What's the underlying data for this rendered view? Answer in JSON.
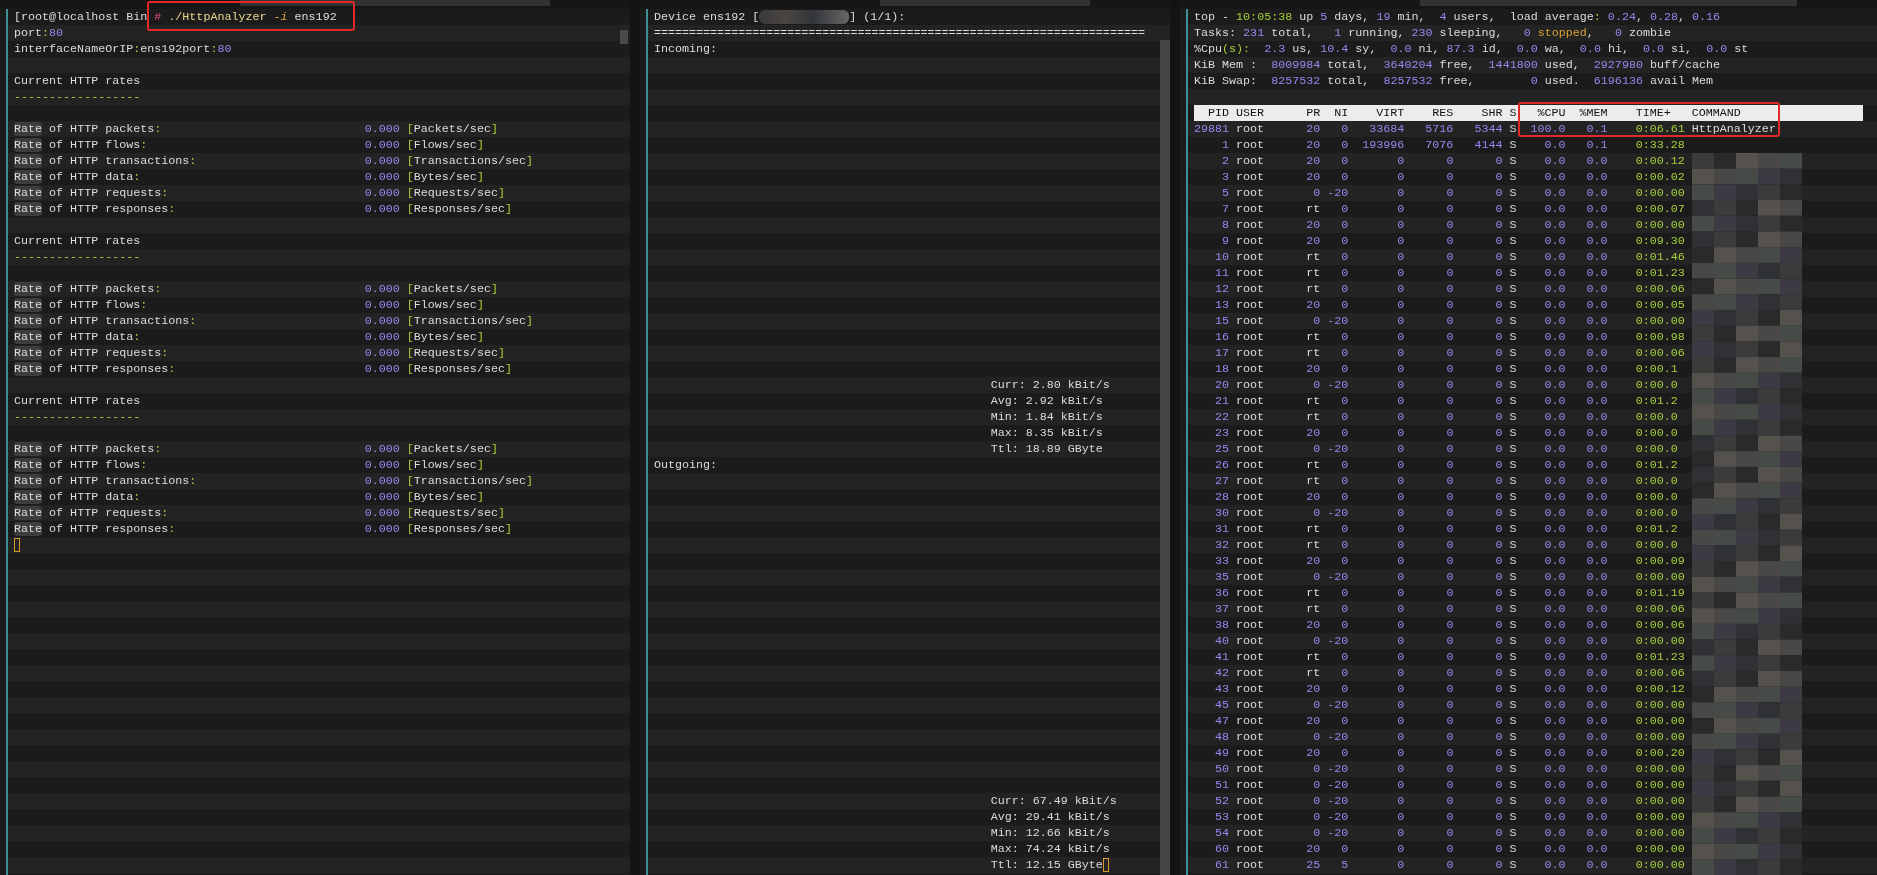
{
  "left": {
    "lines": [
      {
        "kind": "seg",
        "segs": [
          {
            "text": "[root@localhost Bin ",
            "kind": "plain"
          },
          {
            "text": "#",
            "kind": "prompt"
          },
          {
            "text": " ./HttpAnalyzer",
            "kind": "command"
          },
          {
            "text": " -i",
            "kind": "flag"
          },
          {
            "text": " ens192",
            "kind": "plain"
          }
        ]
      },
      {
        "kind": "seg",
        "segs": [
          {
            "text": "port",
            "kind": "plain"
          },
          {
            "text": ":",
            "kind": "punct"
          },
          {
            "text": "80",
            "kind": "number"
          }
        ]
      },
      {
        "kind": "seg",
        "segs": [
          {
            "text": "interfaceNameOrIP",
            "kind": "plain"
          },
          {
            "text": ":",
            "kind": "punct"
          },
          {
            "text": "ens192port",
            "kind": "plain"
          },
          {
            "text": ":",
            "kind": "punct"
          },
          {
            "text": "80",
            "kind": "number"
          }
        ]
      },
      {
        "kind": "blank"
      },
      {
        "kind": "seg",
        "segs": [
          {
            "text": "Current HTTP rates",
            "kind": "plain"
          }
        ]
      },
      {
        "kind": "seg",
        "segs": [
          {
            "text": "------------------",
            "kind": "punct"
          }
        ]
      },
      {
        "kind": "blank"
      },
      {
        "kind": "rate",
        "match": "Rate",
        "label": " of HTTP packets:",
        "value": "0.000",
        "unit": "[Packets/sec]"
      },
      {
        "kind": "rate",
        "match": "Rate",
        "label": " of HTTP flows:",
        "value": "0.000",
        "unit": "[Flows/sec]"
      },
      {
        "kind": "rate",
        "match": "Rate",
        "label": " of HTTP transactions:",
        "value": "0.000",
        "unit": "[Transactions/sec]"
      },
      {
        "kind": "rate",
        "match": "Rate",
        "label": " of HTTP data:",
        "value": "0.000",
        "unit": "[Bytes/sec]"
      },
      {
        "kind": "rate",
        "match": "Rate",
        "label": " of HTTP requests:",
        "value": "0.000",
        "unit": "[Requests/sec]"
      },
      {
        "kind": "rate",
        "match": "Rate",
        "label": " of HTTP responses:",
        "value": "0.000",
        "unit": "[Responses/sec]"
      },
      {
        "kind": "blank"
      },
      {
        "kind": "seg",
        "segs": [
          {
            "text": "Current HTTP rates",
            "kind": "plain"
          }
        ]
      },
      {
        "kind": "seg",
        "segs": [
          {
            "text": "------------------",
            "kind": "punct"
          }
        ]
      },
      {
        "kind": "blank"
      },
      {
        "kind": "rate",
        "match": "Rate",
        "label": " of HTTP packets:",
        "value": "0.000",
        "unit": "[Packets/sec]"
      },
      {
        "kind": "rate",
        "match": "Rate",
        "label": " of HTTP flows:",
        "value": "0.000",
        "unit": "[Flows/sec]"
      },
      {
        "kind": "rate",
        "match": "Rate",
        "label": " of HTTP transactions:",
        "value": "0.000",
        "unit": "[Transactions/sec]"
      },
      {
        "kind": "rate",
        "match": "Rate",
        "label": " of HTTP data:",
        "value": "0.000",
        "unit": "[Bytes/sec]"
      },
      {
        "kind": "rate",
        "match": "Rate",
        "label": " of HTTP requests:",
        "value": "0.000",
        "unit": "[Requests/sec]"
      },
      {
        "kind": "rate",
        "match": "Rate",
        "label": " of HTTP responses:",
        "value": "0.000",
        "unit": "[Responses/sec]"
      },
      {
        "kind": "blank"
      },
      {
        "kind": "seg",
        "segs": [
          {
            "text": "Current HTTP rates",
            "kind": "plain"
          }
        ]
      },
      {
        "kind": "seg",
        "segs": [
          {
            "text": "------------------",
            "kind": "punct"
          }
        ]
      },
      {
        "kind": "blank"
      },
      {
        "kind": "rate",
        "match": "Rate",
        "label": " of HTTP packets:",
        "value": "0.000",
        "unit": "[Packets/sec]"
      },
      {
        "kind": "rate",
        "match": "Rate",
        "label": " of HTTP flows:",
        "value": "0.000",
        "unit": "[Flows/sec]"
      },
      {
        "kind": "rate",
        "match": "Rate",
        "label": " of HTTP transactions:",
        "value": "0.000",
        "unit": "[Transactions/sec]"
      },
      {
        "kind": "rate",
        "match": "Rate",
        "label": " of HTTP data:",
        "value": "0.000",
        "unit": "[Bytes/sec]"
      },
      {
        "kind": "rate",
        "match": "Rate",
        "label": " of HTTP requests:",
        "value": "0.000",
        "unit": "[Requests/sec]"
      },
      {
        "kind": "rate",
        "match": "Rate",
        "label": " of HTTP responses:",
        "value": "0.000",
        "unit": "[Responses/sec]"
      },
      {
        "kind": "cursor"
      }
    ]
  },
  "middle": {
    "device": "Device ens192 [",
    "device_tail": "] (1/1):",
    "rule": "======================================================================",
    "incoming": {
      "label": "Incoming:",
      "stats": [
        "Curr: 2.80 kBit/s",
        "Avg: 2.92 kBit/s",
        "Min: 1.84 kBit/s",
        "Max: 8.35 kBit/s",
        "Ttl: 18.89 GByte"
      ]
    },
    "outgoing": {
      "label": "Outgoing:",
      "stats": [
        "Curr: 67.49 kBit/s",
        "Avg: 29.41 kBit/s",
        "Min: 12.66 kBit/s",
        "Max: 74.24 kBit/s",
        "Ttl: 12.15 GByte"
      ]
    }
  },
  "right": {
    "summary": [
      [
        {
          "text": "top - ",
          "kind": "plain"
        },
        {
          "text": "10:05:38",
          "kind": "punct"
        },
        {
          "text": " up ",
          "kind": "plain"
        },
        {
          "text": "5",
          "kind": "number"
        },
        {
          "text": " days, ",
          "kind": "plain"
        },
        {
          "text": "19",
          "kind": "number"
        },
        {
          "text": " min,  ",
          "kind": "plain"
        },
        {
          "text": "4",
          "kind": "number"
        },
        {
          "text": " users,  load average",
          "kind": "plain"
        },
        {
          "text": ":",
          "kind": "punct"
        },
        {
          "text": " 0.24",
          "kind": "number"
        },
        {
          "text": ", ",
          "kind": "plain"
        },
        {
          "text": "0.28",
          "kind": "number"
        },
        {
          "text": ", ",
          "kind": "plain"
        },
        {
          "text": "0.16",
          "kind": "number"
        }
      ],
      [
        {
          "text": "Tasks: ",
          "kind": "plain"
        },
        {
          "text": "231",
          "kind": "number"
        },
        {
          "text": " total,   ",
          "kind": "plain"
        },
        {
          "text": "1",
          "kind": "number"
        },
        {
          "text": " running, ",
          "kind": "plain"
        },
        {
          "text": "230",
          "kind": "number"
        },
        {
          "text": " sleeping,   ",
          "kind": "plain"
        },
        {
          "text": "0 ",
          "kind": "number"
        },
        {
          "text": "stopped",
          "kind": "warn"
        },
        {
          "text": ",   ",
          "kind": "plain"
        },
        {
          "text": "0",
          "kind": "number"
        },
        {
          "text": " zombie",
          "kind": "plain"
        }
      ],
      [
        {
          "text": "%Cpu",
          "kind": "plain"
        },
        {
          "text": "(s):",
          "kind": "punct"
        },
        {
          "text": "  2.3",
          "kind": "number"
        },
        {
          "text": " us, ",
          "kind": "plain"
        },
        {
          "text": "10.4",
          "kind": "number"
        },
        {
          "text": " sy,  ",
          "kind": "plain"
        },
        {
          "text": "0.0",
          "kind": "number"
        },
        {
          "text": " ni, ",
          "kind": "plain"
        },
        {
          "text": "87.3",
          "kind": "number"
        },
        {
          "text": " id,  ",
          "kind": "plain"
        },
        {
          "text": "0.0",
          "kind": "number"
        },
        {
          "text": " wa,  ",
          "kind": "plain"
        },
        {
          "text": "0.0",
          "kind": "number"
        },
        {
          "text": " hi,  ",
          "kind": "plain"
        },
        {
          "text": "0.0",
          "kind": "number"
        },
        {
          "text": " si,  ",
          "kind": "plain"
        },
        {
          "text": "0.0",
          "kind": "number"
        },
        {
          "text": " st",
          "kind": "plain"
        }
      ],
      [
        {
          "text": "KiB Mem :  ",
          "kind": "plain"
        },
        {
          "text": "8009984",
          "kind": "number"
        },
        {
          "text": " total,  ",
          "kind": "plain"
        },
        {
          "text": "3640204",
          "kind": "number"
        },
        {
          "text": " free,  ",
          "kind": "plain"
        },
        {
          "text": "1441800",
          "kind": "number"
        },
        {
          "text": " used,  ",
          "kind": "plain"
        },
        {
          "text": "2927980",
          "kind": "number"
        },
        {
          "text": " buff/cache",
          "kind": "plain"
        }
      ],
      [
        {
          "text": "KiB Swap:  ",
          "kind": "plain"
        },
        {
          "text": "8257532",
          "kind": "number"
        },
        {
          "text": " total,  ",
          "kind": "plain"
        },
        {
          "text": "8257532",
          "kind": "number"
        },
        {
          "text": " free,        ",
          "kind": "plain"
        },
        {
          "text": "0",
          "kind": "number"
        },
        {
          "text": " used.  ",
          "kind": "plain"
        },
        {
          "text": "6196136",
          "kind": "number"
        },
        {
          "text": " avail Mem",
          "kind": "plain"
        }
      ]
    ],
    "table": {
      "columns": [
        "PID",
        "USER",
        "PR",
        "NI",
        "VIRT",
        "RES",
        "SHR",
        "S",
        "%CPU",
        "%MEM",
        "TIME+",
        "COMMAND"
      ],
      "rows": [
        [
          "29881",
          "root",
          "20",
          "0",
          "33684",
          "5716",
          "5344",
          "S",
          "100.0",
          "0.1",
          "0:06.61",
          "HttpAnalyzer"
        ],
        [
          "1",
          "root",
          "20",
          "0",
          "193996",
          "7076",
          "4144",
          "S",
          "0.0",
          "0.1",
          "0:33.28"
        ],
        [
          "2",
          "root",
          "20",
          "0",
          "0",
          "0",
          "0",
          "S",
          "0.0",
          "0.0",
          "0:00.12"
        ],
        [
          "3",
          "root",
          "20",
          "0",
          "0",
          "0",
          "0",
          "S",
          "0.0",
          "0.0",
          "0:00.02"
        ],
        [
          "5",
          "root",
          "0",
          "-20",
          "0",
          "0",
          "0",
          "S",
          "0.0",
          "0.0",
          "0:00.00"
        ],
        [
          "7",
          "root",
          "rt",
          "0",
          "0",
          "0",
          "0",
          "S",
          "0.0",
          "0.0",
          "0:00.07"
        ],
        [
          "8",
          "root",
          "20",
          "0",
          "0",
          "0",
          "0",
          "S",
          "0.0",
          "0.0",
          "0:00.00"
        ],
        [
          "9",
          "root",
          "20",
          "0",
          "0",
          "0",
          "0",
          "S",
          "0.0",
          "0.0",
          "0:09.30"
        ],
        [
          "10",
          "root",
          "rt",
          "0",
          "0",
          "0",
          "0",
          "S",
          "0.0",
          "0.0",
          "0:01.46"
        ],
        [
          "11",
          "root",
          "rt",
          "0",
          "0",
          "0",
          "0",
          "S",
          "0.0",
          "0.0",
          "0:01.23"
        ],
        [
          "12",
          "root",
          "rt",
          "0",
          "0",
          "0",
          "0",
          "S",
          "0.0",
          "0.0",
          "0:00.06"
        ],
        [
          "13",
          "root",
          "20",
          "0",
          "0",
          "0",
          "0",
          "S",
          "0.0",
          "0.0",
          "0:00.05"
        ],
        [
          "15",
          "root",
          "0",
          "-20",
          "0",
          "0",
          "0",
          "S",
          "0.0",
          "0.0",
          "0:00.00"
        ],
        [
          "16",
          "root",
          "rt",
          "0",
          "0",
          "0",
          "0",
          "S",
          "0.0",
          "0.0",
          "0:00.98"
        ],
        [
          "17",
          "root",
          "rt",
          "0",
          "0",
          "0",
          "0",
          "S",
          "0.0",
          "0.0",
          "0:00.06"
        ],
        [
          "18",
          "root",
          "20",
          "0",
          "0",
          "0",
          "0",
          "S",
          "0.0",
          "0.0",
          "0:00.1"
        ],
        [
          "20",
          "root",
          "0",
          "-20",
          "0",
          "0",
          "0",
          "S",
          "0.0",
          "0.0",
          "0:00.0"
        ],
        [
          "21",
          "root",
          "rt",
          "0",
          "0",
          "0",
          "0",
          "S",
          "0.0",
          "0.0",
          "0:01.2"
        ],
        [
          "22",
          "root",
          "rt",
          "0",
          "0",
          "0",
          "0",
          "S",
          "0.0",
          "0.0",
          "0:00.0"
        ],
        [
          "23",
          "root",
          "20",
          "0",
          "0",
          "0",
          "0",
          "S",
          "0.0",
          "0.0",
          "0:00.0"
        ],
        [
          "25",
          "root",
          "0",
          "-20",
          "0",
          "0",
          "0",
          "S",
          "0.0",
          "0.0",
          "0:00.0"
        ],
        [
          "26",
          "root",
          "rt",
          "0",
          "0",
          "0",
          "0",
          "S",
          "0.0",
          "0.0",
          "0:01.2"
        ],
        [
          "27",
          "root",
          "rt",
          "0",
          "0",
          "0",
          "0",
          "S",
          "0.0",
          "0.0",
          "0:00.0"
        ],
        [
          "28",
          "root",
          "20",
          "0",
          "0",
          "0",
          "0",
          "S",
          "0.0",
          "0.0",
          "0:00.0"
        ],
        [
          "30",
          "root",
          "0",
          "-20",
          "0",
          "0",
          "0",
          "S",
          "0.0",
          "0.0",
          "0:00.0"
        ],
        [
          "31",
          "root",
          "rt",
          "0",
          "0",
          "0",
          "0",
          "S",
          "0.0",
          "0.0",
          "0:01.2"
        ],
        [
          "32",
          "root",
          "rt",
          "0",
          "0",
          "0",
          "0",
          "S",
          "0.0",
          "0.0",
          "0:00.0"
        ],
        [
          "33",
          "root",
          "20",
          "0",
          "0",
          "0",
          "0",
          "S",
          "0.0",
          "0.0",
          "0:00.09"
        ],
        [
          "35",
          "root",
          "0",
          "-20",
          "0",
          "0",
          "0",
          "S",
          "0.0",
          "0.0",
          "0:00.00"
        ],
        [
          "36",
          "root",
          "rt",
          "0",
          "0",
          "0",
          "0",
          "S",
          "0.0",
          "0.0",
          "0:01.19"
        ],
        [
          "37",
          "root",
          "rt",
          "0",
          "0",
          "0",
          "0",
          "S",
          "0.0",
          "0.0",
          "0:00.06"
        ],
        [
          "38",
          "root",
          "20",
          "0",
          "0",
          "0",
          "0",
          "S",
          "0.0",
          "0.0",
          "0:00.06"
        ],
        [
          "40",
          "root",
          "0",
          "-20",
          "0",
          "0",
          "0",
          "S",
          "0.0",
          "0.0",
          "0:00.00"
        ],
        [
          "41",
          "root",
          "rt",
          "0",
          "0",
          "0",
          "0",
          "S",
          "0.0",
          "0.0",
          "0:01.23"
        ],
        [
          "42",
          "root",
          "rt",
          "0",
          "0",
          "0",
          "0",
          "S",
          "0.0",
          "0.0",
          "0:00.06"
        ],
        [
          "43",
          "root",
          "20",
          "0",
          "0",
          "0",
          "0",
          "S",
          "0.0",
          "0.0",
          "0:00.12"
        ],
        [
          "45",
          "root",
          "0",
          "-20",
          "0",
          "0",
          "0",
          "S",
          "0.0",
          "0.0",
          "0:00.00"
        ],
        [
          "47",
          "root",
          "20",
          "0",
          "0",
          "0",
          "0",
          "S",
          "0.0",
          "0.0",
          "0:00.00"
        ],
        [
          "48",
          "root",
          "0",
          "-20",
          "0",
          "0",
          "0",
          "S",
          "0.0",
          "0.0",
          "0:00.00"
        ],
        [
          "49",
          "root",
          "20",
          "0",
          "0",
          "0",
          "0",
          "S",
          "0.0",
          "0.0",
          "0:00.20"
        ],
        [
          "50",
          "root",
          "0",
          "-20",
          "0",
          "0",
          "0",
          "S",
          "0.0",
          "0.0",
          "0:00.00"
        ],
        [
          "51",
          "root",
          "0",
          "-20",
          "0",
          "0",
          "0",
          "S",
          "0.0",
          "0.0",
          "0:00.00"
        ],
        [
          "52",
          "root",
          "0",
          "-20",
          "0",
          "0",
          "0",
          "S",
          "0.0",
          "0.0",
          "0:00.00"
        ],
        [
          "53",
          "root",
          "0",
          "-20",
          "0",
          "0",
          "0",
          "S",
          "0.0",
          "0.0",
          "0:00.00"
        ],
        [
          "54",
          "root",
          "0",
          "-20",
          "0",
          "0",
          "0",
          "S",
          "0.0",
          "0.0",
          "0:00.00"
        ],
        [
          "60",
          "root",
          "20",
          "0",
          "0",
          "0",
          "0",
          "S",
          "0.0",
          "0.0",
          "0:00.00"
        ],
        [
          "61",
          "root",
          "25",
          "5",
          "0",
          "0",
          "0",
          "S",
          "0.0",
          "0.0",
          "0:00.00"
        ]
      ]
    }
  }
}
